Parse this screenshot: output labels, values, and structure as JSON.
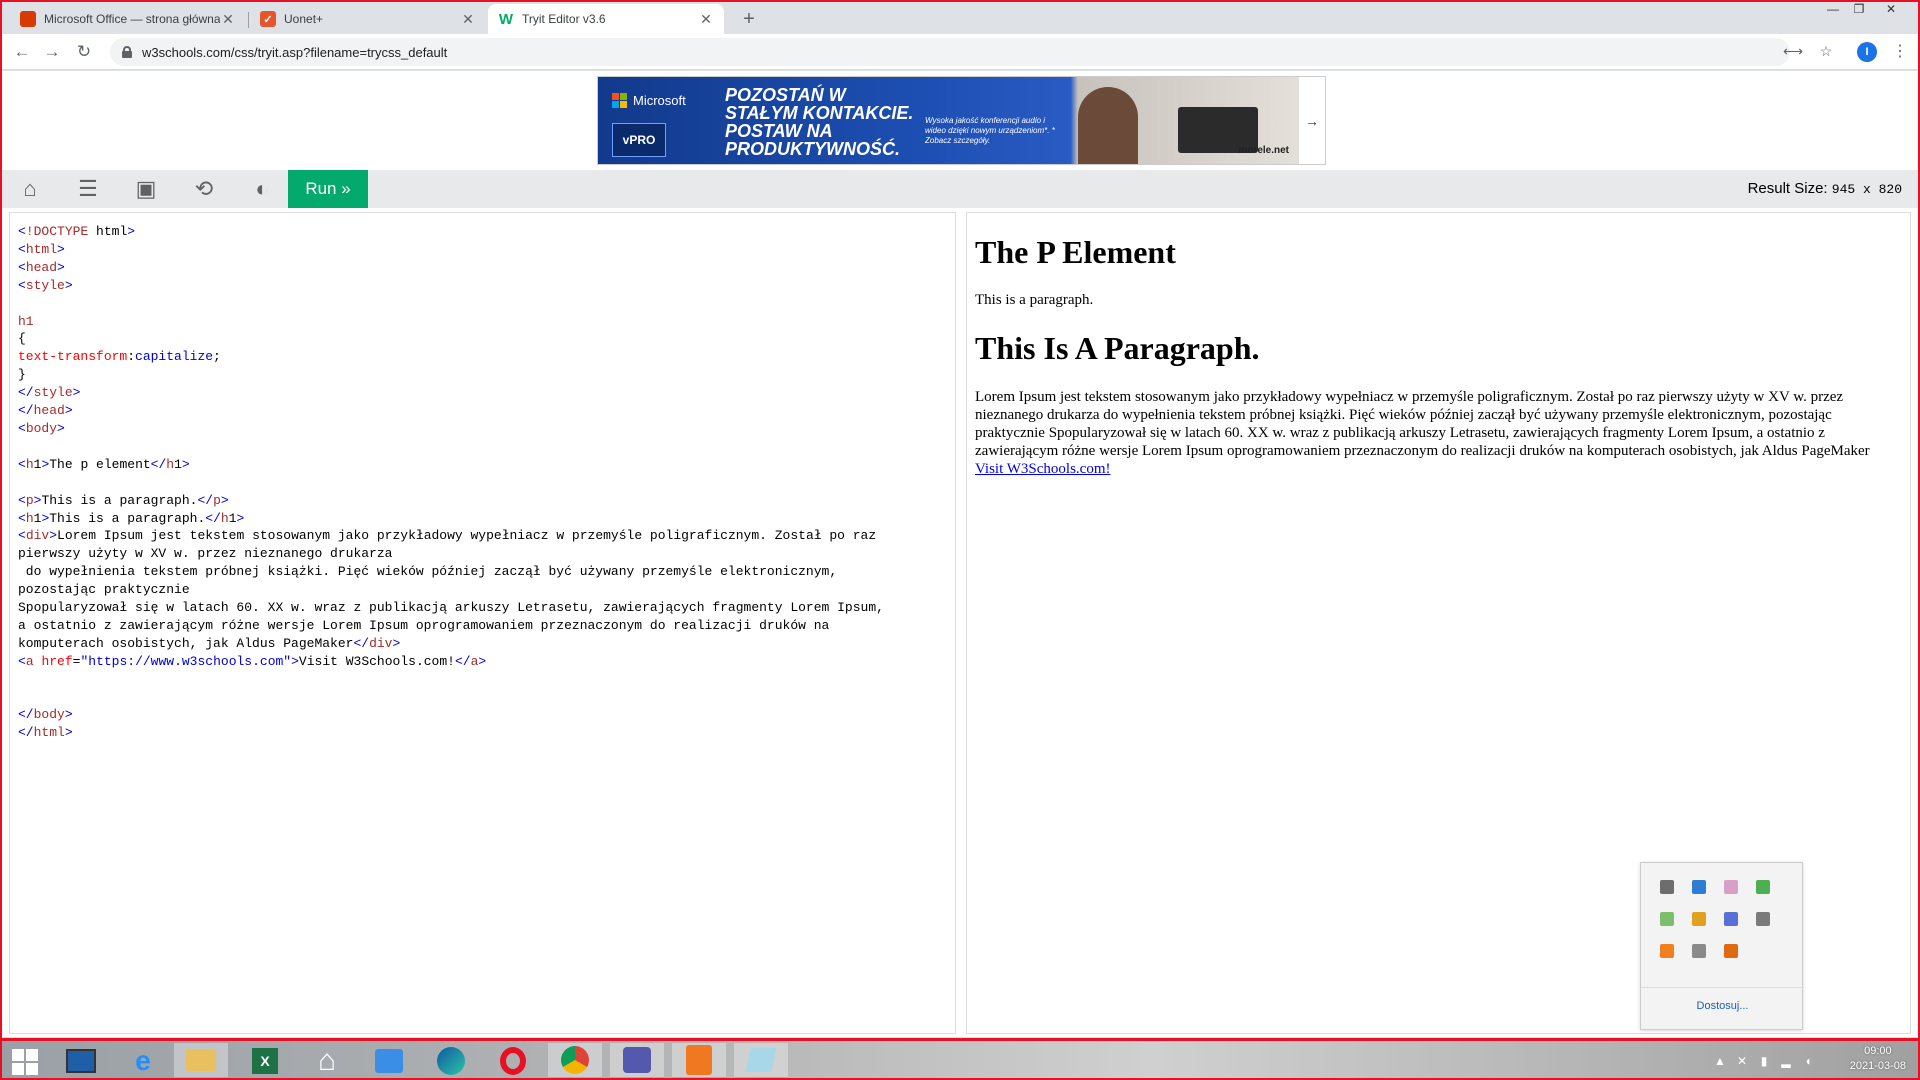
{
  "browser": {
    "tabs": [
      {
        "title": "Microsoft Office — strona główna",
        "icon": "office-icon",
        "active": false
      },
      {
        "title": "Uonet+",
        "icon": "uonet-icon",
        "active": false
      },
      {
        "title": "Tryit Editor v3.6",
        "icon": "w3schools-icon",
        "active": true
      }
    ],
    "new_tab_label": "+",
    "address": "w3schools.com/css/tryit.asp?filename=trycss_default",
    "profile_initial": "I"
  },
  "ad": {
    "brand": "Microsoft",
    "badge": "vPRO",
    "headline": "POZOSTAŃ W STAŁYM KONTAKCIE. POSTAW NA PRODUKTYWNOŚĆ.",
    "small_text": "Wysoka jakość konferencji audio i wideo dzięki nowym urządzeniom*. * Zobacz szczegóły.",
    "shop": "morele.net",
    "arrow": "→"
  },
  "tryit": {
    "run_label": "Run »",
    "result_size_label": "Result Size:",
    "result_size_value": "945 x 820"
  },
  "code_lines": [
    "<!DOCTYPE html>",
    "<html>",
    "<head>",
    "<style>",
    "",
    "h1",
    "{",
    "text-transform:capitalize;",
    "}",
    "</style>",
    "</head>",
    "<body>",
    "",
    "<h1>The p element</h1>",
    "",
    "<p>This is a paragraph.</p>",
    "<h1>This is a paragraph.</h1>",
    "<div>Lorem Ipsum jest tekstem stosowanym jako przykładowy wypełniacz w przemyśle poligraficznym. Został po raz",
    "pierwszy użyty w XV w. przez nieznanego drukarza",
    " do wypełnienia tekstem próbnej książki. Pięć wieków później zaczął być używany przemyśle elektronicznym,",
    "pozostając praktycznie",
    "Spopularyzował się w latach 60. XX w. wraz z publikacją arkuszy Letrasetu, zawierających fragmenty Lorem Ipsum,",
    "a ostatnio z zawierającym różne wersje Lorem Ipsum oprogramowaniem przeznaczonym do realizacji druków na",
    "komputerach osobistych, jak Aldus PageMaker</div>",
    "<a href=\"https://www.w3schools.com\">Visit W3Schools.com!</a>",
    "",
    "",
    "</body>",
    "</html>"
  ],
  "result": {
    "h1_first": "the p element",
    "paragraph": "This is a paragraph.",
    "h1_second": "This is a paragraph.",
    "lorem": "Lorem Ipsum jest tekstem stosowanym jako przykładowy wypełniacz w przemyśle poligraficznym. Został po raz pierwszy użyty w XV w. przez nieznanego drukarza do wypełnienia tekstem próbnej książki. Pięć wieków później zaczął być używany przemyśle elektronicznym, pozostając praktycznie Spopularyzował się w latach 60. XX w. wraz z publikacją arkuszy Letrasetu, zawierających fragmenty Lorem Ipsum, a ostatnio z zawierającym różne wersje Lorem Ipsum oprogramowaniem przeznaczonym do realizacji druków na komputerach osobistych, jak Aldus PageMaker",
    "link": "Visit W3Schools.com!"
  },
  "tray_popup": {
    "customize_label": "Dostosuj...",
    "icons": [
      "#6d6d6d",
      "#2d7dd2",
      "#d6a0c8",
      "#4caf50",
      "#7bbf6a",
      "#e0a020",
      "#5a6fd6",
      "#7a7a7a",
      "#f08020",
      "#8a8a8a",
      "#e06a10"
    ]
  },
  "taskbar": {
    "apps": [
      "lenovo-icon",
      "ie-icon",
      "explorer-icon",
      "excel-icon",
      "home-icon",
      "mail-icon",
      "edge-icon",
      "opera-icon",
      "chrome-icon",
      "teams-icon",
      "pdf-icon",
      "notepad-icon"
    ],
    "time": "09:00",
    "date": "2021-03-08"
  },
  "colors": {
    "w3_green": "#04aa6d",
    "frame_red": "#e81123",
    "link_blue": "#0000ee"
  }
}
